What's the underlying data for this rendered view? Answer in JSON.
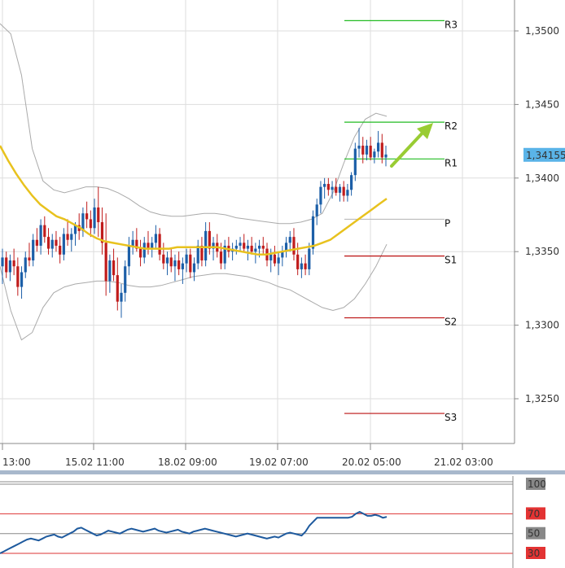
{
  "chart_data": {
    "type": "candlestick",
    "price_axis": {
      "ticks": [
        "1,3500",
        "1,3450",
        "1,3400",
        "1,3350",
        "1,3300",
        "1,3250"
      ],
      "tick_values": [
        1.35,
        1.345,
        1.34,
        1.335,
        1.33,
        1.325
      ],
      "current_price_label": "1,34155",
      "current_price": 1.34155,
      "range": [
        1.322,
        1.3521
      ]
    },
    "time_axis": {
      "labels": [
        "13:00",
        "15.02 11:00",
        "18.02 09:00",
        "19.02 07:00",
        "20.02 05:00",
        "21.02 03:00"
      ]
    },
    "pivot_levels": [
      {
        "label": "R3",
        "value": 1.3507,
        "color": "#22bb22"
      },
      {
        "label": "R2",
        "value": 1.3438,
        "color": "#22bb22"
      },
      {
        "label": "R1",
        "value": 1.3413,
        "color": "#22bb22"
      },
      {
        "label": "P",
        "value": 1.3372,
        "color": "#bbbbbb"
      },
      {
        "label": "S1",
        "value": 1.3347,
        "color": "#bb1111"
      },
      {
        "label": "S2",
        "value": 1.3305,
        "color": "#bb1111"
      },
      {
        "label": "S3",
        "value": 1.324,
        "color": "#bb1111"
      }
    ],
    "candles_ohlc": [
      [
        1.334,
        1.3352,
        1.3328,
        1.3346
      ],
      [
        1.3346,
        1.335,
        1.3332,
        1.3336
      ],
      [
        1.3336,
        1.3348,
        1.333,
        1.3344
      ],
      [
        1.3344,
        1.3352,
        1.3334,
        1.334
      ],
      [
        1.334,
        1.3346,
        1.332,
        1.3326
      ],
      [
        1.3326,
        1.334,
        1.3318,
        1.3336
      ],
      [
        1.3336,
        1.335,
        1.3332,
        1.3346
      ],
      [
        1.3346,
        1.3356,
        1.334,
        1.3344
      ],
      [
        1.3344,
        1.3362,
        1.334,
        1.3358
      ],
      [
        1.3358,
        1.3366,
        1.335,
        1.3354
      ],
      [
        1.3354,
        1.3372,
        1.3348,
        1.3368
      ],
      [
        1.3368,
        1.3374,
        1.3356,
        1.336
      ],
      [
        1.336,
        1.3366,
        1.3348,
        1.3352
      ],
      [
        1.3352,
        1.3362,
        1.3346,
        1.3358
      ],
      [
        1.3358,
        1.3364,
        1.335,
        1.3354
      ],
      [
        1.3354,
        1.336,
        1.3342,
        1.3348
      ],
      [
        1.3348,
        1.3366,
        1.3344,
        1.3362
      ],
      [
        1.3362,
        1.3372,
        1.3354,
        1.3358
      ],
      [
        1.3358,
        1.3366,
        1.335,
        1.3362
      ],
      [
        1.3362,
        1.337,
        1.3354,
        1.3368
      ],
      [
        1.3368,
        1.3376,
        1.3358,
        1.3364
      ],
      [
        1.3364,
        1.338,
        1.336,
        1.3376
      ],
      [
        1.3376,
        1.3384,
        1.3366,
        1.3372
      ],
      [
        1.3372,
        1.3378,
        1.336,
        1.3366
      ],
      [
        1.3366,
        1.3386,
        1.3362,
        1.338
      ],
      [
        1.338,
        1.3394,
        1.336,
        1.337
      ],
      [
        1.337,
        1.338,
        1.3348,
        1.3356
      ],
      [
        1.3356,
        1.3376,
        1.332,
        1.333
      ],
      [
        1.333,
        1.3348,
        1.3322,
        1.3344
      ],
      [
        1.3344,
        1.3352,
        1.333,
        1.3334
      ],
      [
        1.3334,
        1.3346,
        1.331,
        1.3316
      ],
      [
        1.3316,
        1.3328,
        1.3305,
        1.3322
      ],
      [
        1.3322,
        1.3344,
        1.3316,
        1.334
      ],
      [
        1.334,
        1.336,
        1.3334,
        1.3354
      ],
      [
        1.3354,
        1.3364,
        1.3348,
        1.3358
      ],
      [
        1.3358,
        1.3366,
        1.335,
        1.3352
      ],
      [
        1.3352,
        1.3358,
        1.334,
        1.3346
      ],
      [
        1.3346,
        1.336,
        1.3342,
        1.3356
      ],
      [
        1.3356,
        1.3364,
        1.3348,
        1.3352
      ],
      [
        1.3352,
        1.336,
        1.3346,
        1.3356
      ],
      [
        1.3356,
        1.3368,
        1.3352,
        1.3362
      ],
      [
        1.3362,
        1.3366,
        1.3344,
        1.3348
      ],
      [
        1.3348,
        1.3356,
        1.3338,
        1.3342
      ],
      [
        1.3342,
        1.335,
        1.3334,
        1.3346
      ],
      [
        1.3346,
        1.3352,
        1.3336,
        1.334
      ],
      [
        1.334,
        1.3348,
        1.333,
        1.3344
      ],
      [
        1.3344,
        1.335,
        1.3334,
        1.3338
      ],
      [
        1.3338,
        1.3346,
        1.3328,
        1.3342
      ],
      [
        1.3342,
        1.3352,
        1.3336,
        1.3348
      ],
      [
        1.3348,
        1.3352,
        1.3332,
        1.3336
      ],
      [
        1.3336,
        1.3346,
        1.333,
        1.3342
      ],
      [
        1.3342,
        1.3358,
        1.3338,
        1.3354
      ],
      [
        1.3354,
        1.336,
        1.334,
        1.3344
      ],
      [
        1.3344,
        1.337,
        1.334,
        1.3364
      ],
      [
        1.3364,
        1.337,
        1.3348,
        1.3352
      ],
      [
        1.3352,
        1.336,
        1.3344,
        1.3356
      ],
      [
        1.3356,
        1.3362,
        1.3346,
        1.335
      ],
      [
        1.335,
        1.3356,
        1.3338,
        1.3342
      ],
      [
        1.3342,
        1.3358,
        1.3338,
        1.3354
      ],
      [
        1.3354,
        1.336,
        1.3346,
        1.335
      ],
      [
        1.335,
        1.3356,
        1.3344,
        1.3352
      ],
      [
        1.3352,
        1.3358,
        1.3348,
        1.3354
      ],
      [
        1.3354,
        1.336,
        1.335,
        1.3356
      ],
      [
        1.3356,
        1.3362,
        1.335,
        1.3352
      ],
      [
        1.3352,
        1.3358,
        1.3344,
        1.3354
      ],
      [
        1.3354,
        1.336,
        1.3348,
        1.335
      ],
      [
        1.335,
        1.3356,
        1.3342,
        1.3352
      ],
      [
        1.3352,
        1.3358,
        1.3346,
        1.3354
      ],
      [
        1.3354,
        1.336,
        1.3348,
        1.3352
      ],
      [
        1.3352,
        1.3356,
        1.334,
        1.3344
      ],
      [
        1.3344,
        1.3352,
        1.3336,
        1.3348
      ],
      [
        1.3348,
        1.3354,
        1.334,
        1.3342
      ],
      [
        1.3342,
        1.335,
        1.3334,
        1.3346
      ],
      [
        1.3346,
        1.3354,
        1.334,
        1.335
      ],
      [
        1.335,
        1.336,
        1.3346,
        1.3356
      ],
      [
        1.3356,
        1.3364,
        1.335,
        1.336
      ],
      [
        1.336,
        1.3366,
        1.3344,
        1.3348
      ],
      [
        1.3348,
        1.3356,
        1.3334,
        1.3338
      ],
      [
        1.3338,
        1.3346,
        1.3332,
        1.3342
      ],
      [
        1.3342,
        1.3348,
        1.3334,
        1.3338
      ],
      [
        1.3338,
        1.3356,
        1.3334,
        1.3352
      ],
      [
        1.3352,
        1.3378,
        1.3348,
        1.3374
      ],
      [
        1.3374,
        1.3386,
        1.3368,
        1.3382
      ],
      [
        1.3382,
        1.3398,
        1.3376,
        1.3394
      ],
      [
        1.3394,
        1.34,
        1.3386,
        1.3396
      ],
      [
        1.3396,
        1.34,
        1.3388,
        1.3392
      ],
      [
        1.3392,
        1.3398,
        1.3386,
        1.3394
      ],
      [
        1.3394,
        1.34,
        1.3388,
        1.339
      ],
      [
        1.339,
        1.3396,
        1.3384,
        1.3394
      ],
      [
        1.3394,
        1.3398,
        1.3384,
        1.3388
      ],
      [
        1.3388,
        1.3396,
        1.3384,
        1.3392
      ],
      [
        1.3392,
        1.3404,
        1.3388,
        1.3402
      ],
      [
        1.3402,
        1.3424,
        1.3398,
        1.342
      ],
      [
        1.342,
        1.3434,
        1.3414,
        1.3422
      ],
      [
        1.3422,
        1.3428,
        1.341,
        1.3416
      ],
      [
        1.3416,
        1.3426,
        1.3412,
        1.3422
      ],
      [
        1.3422,
        1.3428,
        1.3412,
        1.3414
      ],
      [
        1.3414,
        1.342,
        1.341,
        1.3418
      ],
      [
        1.3418,
        1.3432,
        1.3414,
        1.3424
      ],
      [
        1.3424,
        1.343,
        1.341,
        1.3414
      ],
      [
        1.3414,
        1.3422,
        1.3408,
        1.3416
      ]
    ],
    "ma_series": [
      1.3422,
      1.3412,
      1.3403,
      1.3395,
      1.3388,
      1.3382,
      1.3378,
      1.3374,
      1.3372,
      1.3369,
      1.3366,
      1.3362,
      1.3359,
      1.3357,
      1.3356,
      1.3355,
      1.3354,
      1.3353,
      1.3352,
      1.3352,
      1.3352,
      1.3352,
      1.3353,
      1.3353,
      1.3353,
      1.3353,
      1.3353,
      1.3353,
      1.3352,
      1.3351,
      1.335,
      1.3349,
      1.3348,
      1.3348,
      1.3349,
      1.335,
      1.3351,
      1.3352,
      1.3353,
      1.3354,
      1.3356,
      1.3358,
      1.3362,
      1.3366,
      1.337,
      1.3374,
      1.3378,
      1.3382,
      1.3386
    ],
    "bollinger_upper": [
      1.3505,
      1.3498,
      1.347,
      1.342,
      1.3398,
      1.3392,
      1.339,
      1.3392,
      1.3394,
      1.3394,
      1.3393,
      1.339,
      1.3386,
      1.3381,
      1.3377,
      1.3375,
      1.3374,
      1.3374,
      1.3375,
      1.3376,
      1.3376,
      1.3375,
      1.3373,
      1.3372,
      1.3371,
      1.337,
      1.3369,
      1.3369,
      1.337,
      1.3372,
      1.3376,
      1.339,
      1.341,
      1.3428,
      1.344,
      1.3444,
      1.3442
    ],
    "bollinger_lower": [
      1.334,
      1.331,
      1.329,
      1.3295,
      1.3312,
      1.3322,
      1.3326,
      1.3328,
      1.3329,
      1.333,
      1.333,
      1.3329,
      1.3327,
      1.3326,
      1.3326,
      1.3327,
      1.3329,
      1.3331,
      1.3333,
      1.3334,
      1.3335,
      1.3335,
      1.3334,
      1.3333,
      1.3331,
      1.3329,
      1.3326,
      1.3324,
      1.332,
      1.3316,
      1.3312,
      1.331,
      1.3312,
      1.3318,
      1.3328,
      1.334,
      1.3355
    ],
    "rsi_panel": {
      "labels": [
        "100",
        "70",
        "50",
        "30"
      ],
      "levels": [
        100,
        70,
        50,
        30
      ],
      "values": [
        30,
        32,
        34,
        36,
        38,
        40,
        42,
        44,
        45,
        44,
        43,
        45,
        47,
        48,
        49,
        47,
        46,
        48,
        50,
        52,
        55,
        56,
        54,
        52,
        50,
        48,
        49,
        51,
        53,
        52,
        51,
        50,
        52,
        54,
        55,
        54,
        53,
        52,
        53,
        54,
        55,
        53,
        52,
        51,
        52,
        53,
        54,
        52,
        51,
        50,
        52,
        53,
        54,
        55,
        54,
        53,
        52,
        51,
        50,
        49,
        48,
        47,
        48,
        49,
        50,
        49,
        48,
        47,
        46,
        45,
        46,
        47,
        46,
        48,
        50,
        51,
        50,
        49,
        48,
        52,
        58,
        62,
        66,
        66,
        66,
        66,
        66,
        66,
        66,
        66,
        66,
        67,
        70,
        72,
        70,
        68,
        68,
        69,
        68,
        66,
        67
      ]
    },
    "annotation": {
      "type": "arrow",
      "color": "#99cc33",
      "direction": "up-right"
    },
    "grid": true,
    "colors": {
      "bull": "#1c5fa8",
      "bear": "#c01c1c",
      "ma": "#e8c21e",
      "bollinger": "#aaaaaa",
      "rsi_line": "#1e5a9e",
      "separator": "#a8b8cc",
      "current_price_bg": "#5ab4e8"
    }
  }
}
